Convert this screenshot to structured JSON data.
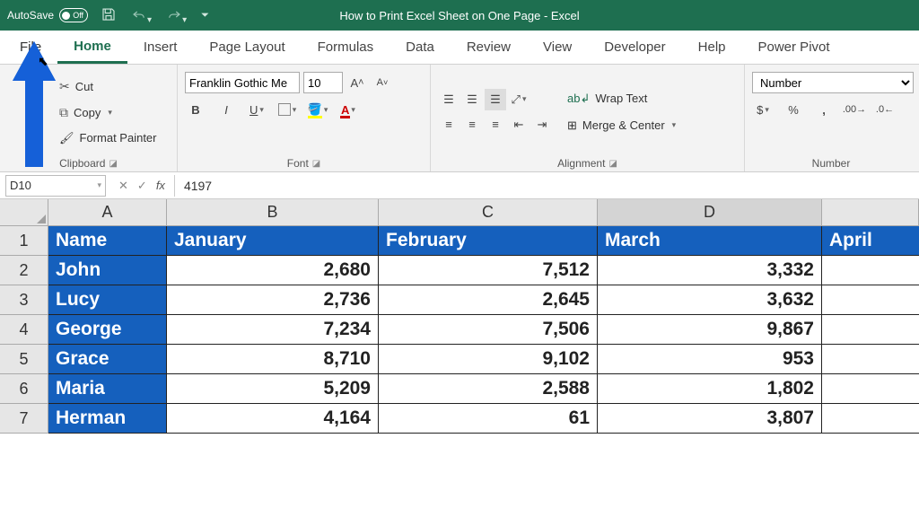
{
  "titlebar": {
    "autosave": "AutoSave",
    "off": "Off",
    "title": "How to Print Excel Sheet on One Page  -  Excel"
  },
  "tabs": [
    "File",
    "Home",
    "Insert",
    "Page Layout",
    "Formulas",
    "Data",
    "Review",
    "View",
    "Developer",
    "Help",
    "Power Pivot"
  ],
  "clipboard": {
    "cut": "Cut",
    "copy": "Copy",
    "format": "Format Painter",
    "label": "Clipboard"
  },
  "font": {
    "name": "Franklin Gothic Me",
    "size": "10",
    "label": "Font"
  },
  "alignment": {
    "wrap": "Wrap Text",
    "merge": "Merge & Center",
    "label": "Alignment"
  },
  "number": {
    "format": "Number",
    "label": "Number"
  },
  "namebox": "D10",
  "formula": "4197",
  "cols": [
    "A",
    "B",
    "C",
    "D"
  ],
  "grid": {
    "headers": [
      "Name",
      "January",
      "February",
      "March",
      "April"
    ],
    "rows": [
      {
        "n": "1"
      },
      {
        "n": "2",
        "name": "John",
        "jan": "2,680",
        "feb": "7,512",
        "mar": "3,332"
      },
      {
        "n": "3",
        "name": "Lucy",
        "jan": "2,736",
        "feb": "2,645",
        "mar": "3,632"
      },
      {
        "n": "4",
        "name": "George",
        "jan": "7,234",
        "feb": "7,506",
        "mar": "9,867"
      },
      {
        "n": "5",
        "name": "Grace",
        "jan": "8,710",
        "feb": "9,102",
        "mar": "953"
      },
      {
        "n": "6",
        "name": "Maria",
        "jan": "5,209",
        "feb": "2,588",
        "mar": "1,802"
      },
      {
        "n": "7",
        "name": "Herman",
        "jan": "4,164",
        "feb": "61",
        "mar": "3,807"
      }
    ]
  }
}
